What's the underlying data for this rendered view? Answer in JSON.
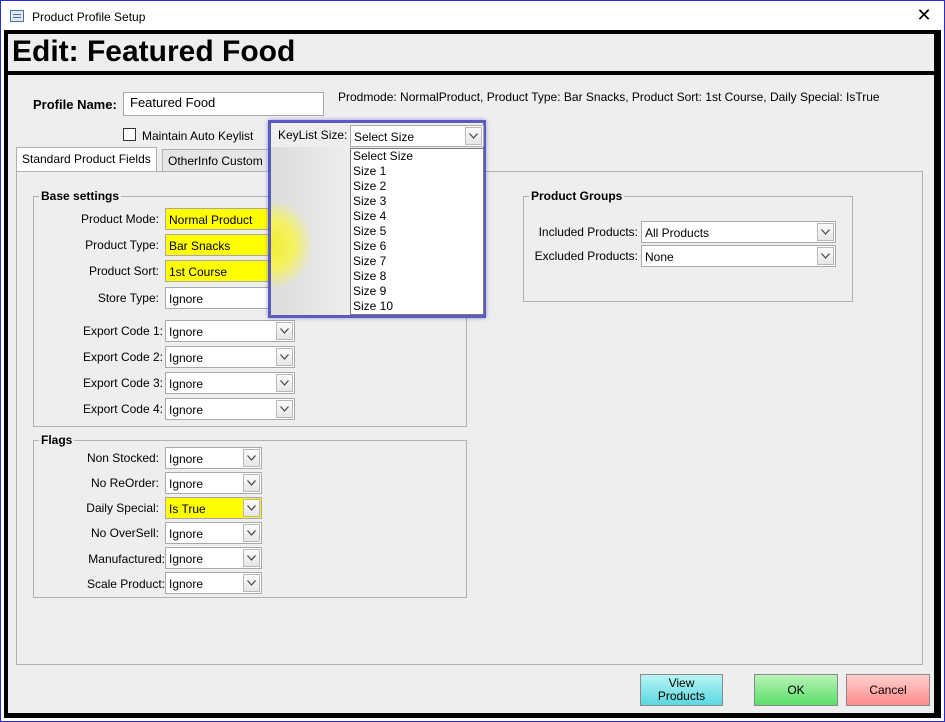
{
  "window": {
    "title": "Product Profile Setup",
    "close_glyph": "✕"
  },
  "header": {
    "title": "Edit: Featured Food"
  },
  "profile": {
    "name_label": "Profile Name:",
    "name_value": "Featured Food",
    "summary": "Prodmode: NormalProduct, Product Type: Bar Snacks, Product Sort: 1st Course, Daily Special: IsTrue",
    "maintain_label": "Maintain Auto Keylist",
    "maintain_checked": false
  },
  "keylist": {
    "label": "KeyList Size:",
    "selected": "Select Size",
    "options": [
      "Select Size",
      "Size 1",
      "Size 2",
      "Size 3",
      "Size 4",
      "Size 5",
      "Size 6",
      "Size 7",
      "Size 8",
      "Size 9",
      "Size 10"
    ]
  },
  "tabs": [
    {
      "label": "Standard Product Fields",
      "active": true
    },
    {
      "label": "OtherInfo Custom",
      "active": false
    }
  ],
  "base_settings": {
    "title": "Base settings",
    "product_mode": {
      "label": "Product Mode:",
      "value": "Normal Product"
    },
    "product_type": {
      "label": "Product Type:",
      "value": "Bar Snacks"
    },
    "product_sort": {
      "label": "Product Sort:",
      "value": "1st Course"
    },
    "store_type": {
      "label": "Store Type:",
      "value": "Ignore"
    },
    "export1": {
      "label": "Export Code 1:",
      "value": "Ignore"
    },
    "export2": {
      "label": "Export Code 2:",
      "value": "Ignore"
    },
    "export3": {
      "label": "Export Code 3:",
      "value": "Ignore"
    },
    "export4": {
      "label": "Export Code 4:",
      "value": "Ignore"
    }
  },
  "flags": {
    "title": "Flags",
    "non_stocked": {
      "label": "Non Stocked:",
      "value": "Ignore"
    },
    "no_reorder": {
      "label": "No ReOrder:",
      "value": "Ignore"
    },
    "daily_special": {
      "label": "Daily Special:",
      "value": "Is True"
    },
    "no_oversell": {
      "label": "No OverSell:",
      "value": "Ignore"
    },
    "manufactured": {
      "label": "Manufactured:",
      "value": "Ignore"
    },
    "scale_product": {
      "label": "Scale Product:",
      "value": "Ignore"
    }
  },
  "product_groups": {
    "title": "Product Groups",
    "included": {
      "label": "Included Products:",
      "value": "All Products"
    },
    "excluded": {
      "label": "Excluded Products:",
      "value": "None"
    }
  },
  "buttons": {
    "view_line1": "View",
    "view_line2": "Products",
    "ok": "OK",
    "cancel": "Cancel"
  },
  "colors": {
    "highlight": "#ffff00",
    "border": "#2b2bd6"
  }
}
